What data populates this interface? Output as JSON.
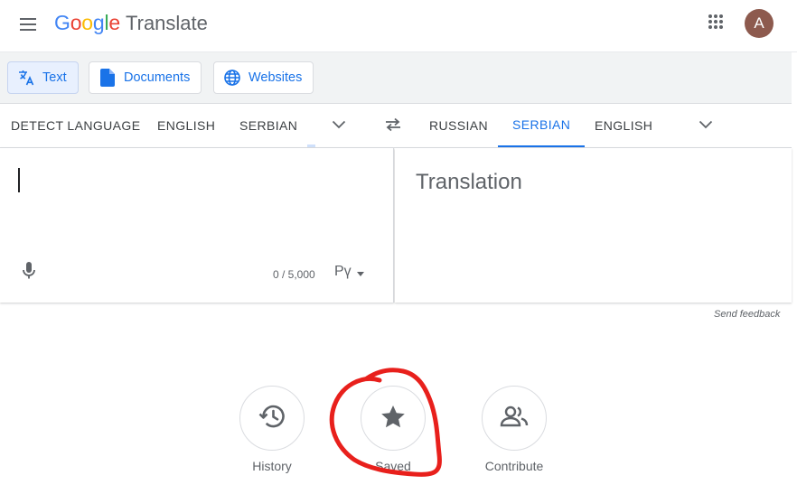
{
  "header": {
    "logo_letters": [
      {
        "ch": "G",
        "color": "#4285F4"
      },
      {
        "ch": "o",
        "color": "#EA4335"
      },
      {
        "ch": "o",
        "color": "#FBBC05"
      },
      {
        "ch": "g",
        "color": "#4285F4"
      },
      {
        "ch": "l",
        "color": "#34A853"
      },
      {
        "ch": "e",
        "color": "#EA4335"
      }
    ],
    "product": "Translate",
    "avatar_initial": "A"
  },
  "modes": {
    "text": "Text",
    "documents": "Documents",
    "websites": "Websites"
  },
  "languages": {
    "source": [
      "DETECT LANGUAGE",
      "ENGLISH",
      "SERBIAN"
    ],
    "target": [
      "RUSSIAN",
      "SERBIAN",
      "ENGLISH"
    ],
    "active_target": "SERBIAN"
  },
  "source_panel": {
    "text": "",
    "char_count": "0 / 5,000",
    "ime_label": "Рү"
  },
  "target_panel": {
    "placeholder": "Translation"
  },
  "feedback": "Send feedback",
  "bottom_actions": {
    "history": "History",
    "saved": "Saved",
    "contribute": "Contribute"
  },
  "colors": {
    "accent": "#1a73e8",
    "annotation": "#e8201c"
  },
  "icons": [
    "menu-icon",
    "apps-grid-icon",
    "translate-icon",
    "document-icon",
    "globe-icon",
    "chevron-down-icon",
    "swap-icon",
    "mic-icon",
    "history-icon",
    "star-icon",
    "people-icon"
  ]
}
